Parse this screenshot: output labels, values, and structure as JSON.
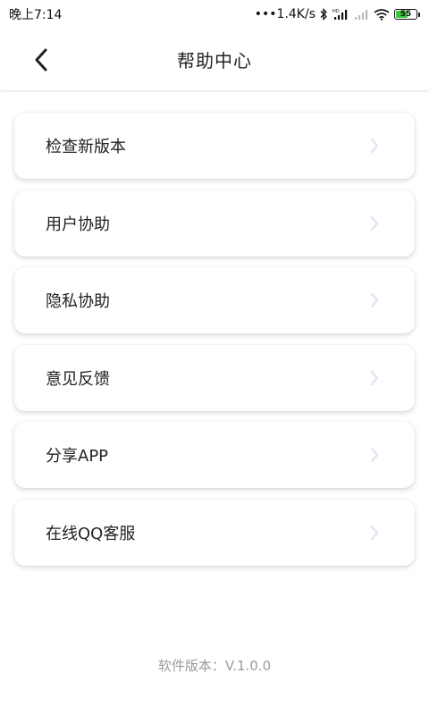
{
  "status_bar": {
    "time": "晚上7:14",
    "network_speed": "•••1.4K/s",
    "battery_level": "55",
    "icons": [
      "bluetooth-icon",
      "signal-hd-icon",
      "signal-weak-icon",
      "wifi-icon",
      "battery-icon"
    ]
  },
  "header": {
    "title": "帮助中心",
    "back_icon": "chevron-left-icon"
  },
  "menu": {
    "items": [
      {
        "label": "检查新版本"
      },
      {
        "label": "用户协助"
      },
      {
        "label": "隐私协助"
      },
      {
        "label": "意见反馈"
      },
      {
        "label": "分享APP"
      },
      {
        "label": "在线QQ客服"
      }
    ],
    "chevron_icon": "chevron-right-icon"
  },
  "footer": {
    "version": "软件版本：V.1.0.0"
  },
  "colors": {
    "battery_fill": "#3cc83c",
    "chevron": "#dde6f2",
    "version_text": "#9a9a9a"
  }
}
